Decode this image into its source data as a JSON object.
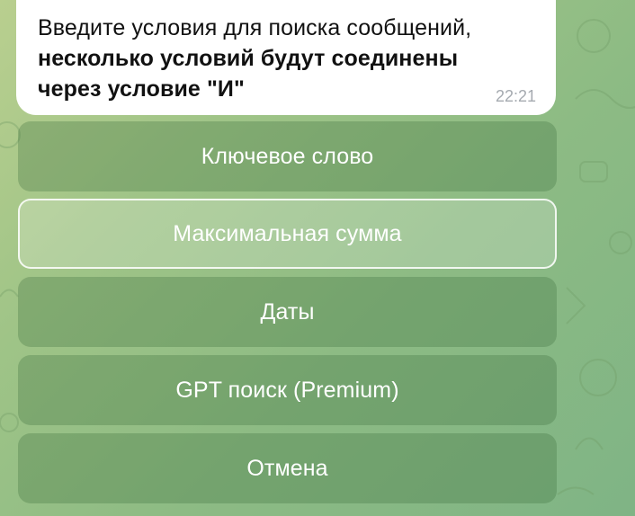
{
  "message": {
    "line1": "Введите условия для поиска сообщений,",
    "line2": "несколько условий будут соединены",
    "line3": "через условие \"И\"",
    "time": "22:21"
  },
  "keyboard": {
    "buttons": [
      {
        "label": "Ключевое слово"
      },
      {
        "label": "Максимальная сумма"
      },
      {
        "label": "Даты"
      },
      {
        "label": "GPT поиск (Premium)"
      },
      {
        "label": "Отмена"
      }
    ]
  },
  "colors": {
    "bubble": "#ffffff",
    "time_text": "#a5aab0",
    "button_text": "#ffffff",
    "wallpaper": "#8dbb84"
  }
}
